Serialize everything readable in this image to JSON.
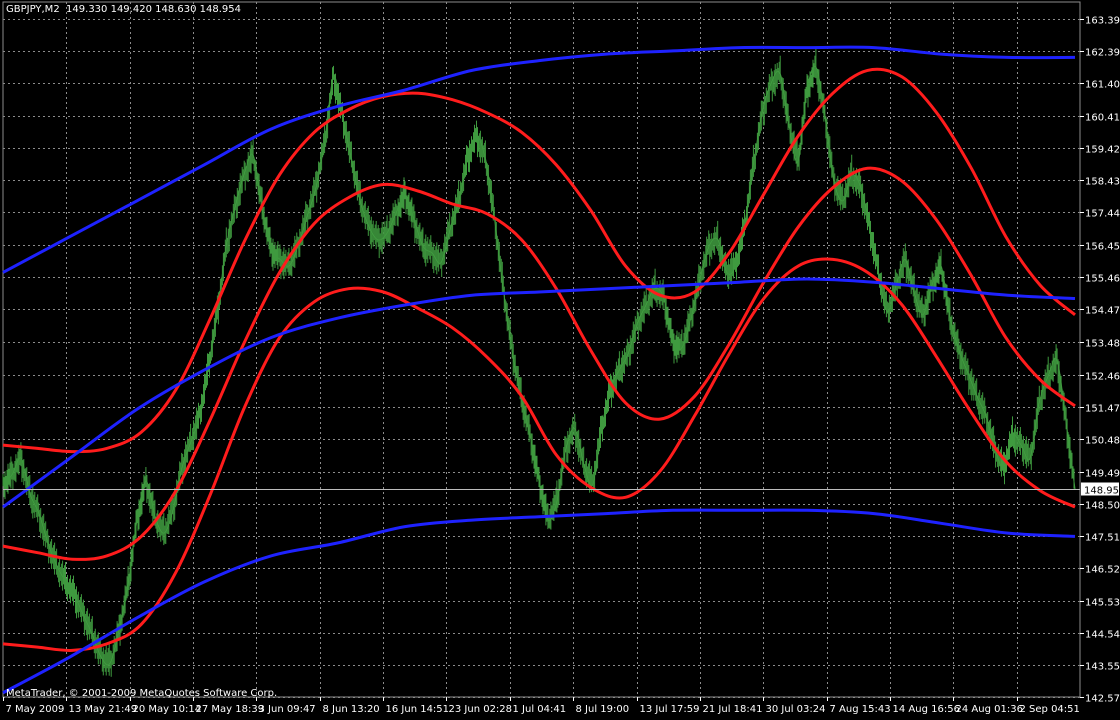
{
  "header": {
    "symbol": "GBPJPY,M2",
    "ohlc": "149.330 149.420 148.630 148.954"
  },
  "footer": {
    "copyright": "MetaTrader, © 2001-2009 MetaQuotes Software Corp."
  },
  "colors": {
    "background": "#000000",
    "grid": "#8c8c8c",
    "price": "#3f9a3f",
    "channel_red": "#ff1c1c",
    "channel_blue": "#1e22ff",
    "axis_text": "#ffffff",
    "current_price_box": "#ffffff"
  },
  "chart_data": {
    "type": "line",
    "title": "",
    "xlabel": "",
    "ylabel": "",
    "grid": true,
    "ylim": [
      142.57,
      163.9
    ],
    "y_ticks": [
      "163.390",
      "162.390",
      "161.400",
      "160.410",
      "159.420",
      "158.430",
      "157.440",
      "156.450",
      "155.460",
      "154.470",
      "153.480",
      "152.460",
      "151.470",
      "150.480",
      "149.490",
      "148.500",
      "147.510",
      "146.520",
      "145.530",
      "144.540",
      "143.550",
      "142.570"
    ],
    "x_ticks": [
      "7 May 2009",
      "13 May 21:49",
      "20 May 10:14",
      "27 May 18:39",
      "3 Jun 09:47",
      "8 Jun 13:20",
      "16 Jun 14:51",
      "23 Jun 02:28",
      "1 Jul 04:41",
      "8 Jul 19:00",
      "13 Jul 17:59",
      "21 Jul 18:41",
      "30 Jul 03:24",
      "7 Aug 15:43",
      "14 Aug 16:56",
      "24 Aug 01:36",
      "2 Sep 04:51"
    ],
    "current_price": "148.954",
    "series": [
      {
        "role": "price",
        "color": "#3f9a3f",
        "values": [
          149.1,
          149.4,
          149.9,
          148.8,
          148.2,
          147.3,
          146.6,
          146.1,
          145.7,
          145.1,
          144.5,
          143.8,
          143.6,
          144.6,
          146.0,
          148.0,
          149.2,
          148.1,
          147.6,
          148.3,
          149.6,
          150.4,
          151.2,
          152.7,
          154.4,
          156.4,
          157.6,
          158.6,
          159.2,
          157.6,
          156.3,
          156.0,
          155.8,
          156.4,
          157.3,
          158.2,
          159.6,
          161.6,
          160.4,
          159.1,
          157.8,
          157.0,
          156.6,
          156.8,
          157.4,
          158.0,
          157.2,
          156.4,
          156.2,
          155.9,
          156.9,
          157.8,
          159.1,
          159.8,
          159.1,
          157.3,
          155.1,
          153.2,
          151.8,
          150.6,
          149.2,
          148.0,
          148.6,
          150.2,
          150.8,
          149.7,
          149.1,
          150.8,
          152.0,
          152.6,
          153.1,
          154.0,
          154.6,
          155.1,
          154.8,
          153.4,
          153.3,
          154.2,
          155.4,
          156.4,
          156.6,
          155.6,
          155.8,
          157.0,
          158.9,
          160.5,
          161.4,
          161.7,
          160.1,
          159.0,
          161.2,
          161.9,
          160.4,
          158.4,
          157.8,
          158.6,
          158.2,
          157.0,
          155.6,
          154.4,
          155.2,
          156.0,
          155.0,
          154.3,
          155.2,
          155.8,
          154.2,
          153.2,
          152.5,
          151.8,
          151.2,
          150.2,
          149.6,
          150.6,
          150.3,
          149.9,
          151.6,
          152.4,
          152.9,
          151.0,
          148.954
        ]
      },
      {
        "role": "red-upper",
        "color": "#ff1c1c",
        "values": [
          150.3,
          150.2,
          150.1,
          150.2,
          150.7,
          152.0,
          154.2,
          156.6,
          158.6,
          159.9,
          160.6,
          161.0,
          161.1,
          160.9,
          160.5,
          159.9,
          158.9,
          157.5,
          155.8,
          154.9,
          155.0,
          156.2,
          158.0,
          159.8,
          161.1,
          161.8,
          161.6,
          160.5,
          158.8,
          156.7,
          155.2,
          154.3
        ]
      },
      {
        "role": "red-middle",
        "color": "#ff1c1c",
        "values": [
          147.2,
          147.0,
          146.8,
          146.9,
          147.5,
          148.9,
          151.1,
          153.5,
          155.6,
          157.1,
          157.9,
          158.3,
          158.1,
          157.7,
          157.4,
          156.6,
          155.1,
          153.2,
          151.6,
          151.1,
          151.8,
          153.4,
          155.3,
          157.0,
          158.2,
          158.8,
          158.4,
          157.2,
          155.5,
          153.6,
          152.3,
          151.5
        ]
      },
      {
        "role": "red-lower",
        "color": "#ff1c1c",
        "values": [
          144.2,
          144.1,
          144.0,
          144.2,
          144.8,
          146.4,
          148.8,
          151.5,
          153.6,
          154.7,
          155.1,
          155.0,
          154.5,
          153.9,
          153.0,
          151.8,
          150.0,
          149.0,
          148.7,
          149.5,
          151.2,
          153.1,
          154.8,
          155.8,
          156.0,
          155.6,
          154.6,
          153.0,
          151.3,
          149.8,
          148.9,
          148.4
        ]
      },
      {
        "role": "blue-upper",
        "color": "#1e22ff",
        "values": [
          155.6,
          156.7,
          157.8,
          158.9,
          160.0,
          160.7,
          161.2,
          161.8,
          162.1,
          162.3,
          162.4,
          162.5,
          162.5,
          162.5,
          162.3,
          162.2,
          162.2
        ]
      },
      {
        "role": "blue-middle",
        "color": "#1e22ff",
        "values": [
          148.4,
          149.9,
          151.4,
          152.6,
          153.6,
          154.2,
          154.6,
          154.9,
          155.0,
          155.1,
          155.2,
          155.3,
          155.4,
          155.3,
          155.1,
          154.9,
          154.8
        ]
      },
      {
        "role": "blue-lower",
        "color": "#1e22ff",
        "values": [
          142.7,
          143.8,
          145.0,
          146.1,
          146.9,
          147.3,
          147.8,
          148.0,
          148.1,
          148.2,
          148.3,
          148.3,
          148.3,
          148.2,
          147.9,
          147.6,
          147.5
        ]
      }
    ]
  }
}
